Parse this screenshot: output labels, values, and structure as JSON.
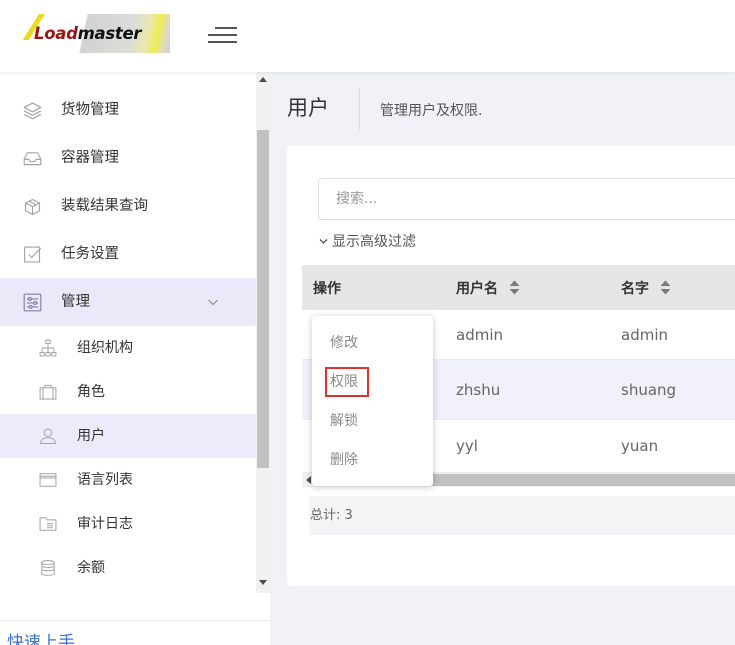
{
  "header": {
    "logo": {
      "part1": "Load",
      "part2": "master"
    },
    "menu_icon": "hamburger-icon"
  },
  "sidebar": {
    "items": [
      {
        "label": "货物管理",
        "icon": "layers-icon"
      },
      {
        "label": "容器管理",
        "icon": "inbox-icon"
      },
      {
        "label": "装载结果查询",
        "icon": "package-icon"
      },
      {
        "label": "任务设置",
        "icon": "checkbox-icon"
      },
      {
        "label": "管理",
        "icon": "sliders-icon",
        "active": true,
        "expanded": true
      }
    ],
    "sub_items": [
      {
        "label": "组织机构",
        "icon": "org-chart-icon"
      },
      {
        "label": "角色",
        "icon": "briefcase-icon"
      },
      {
        "label": "用户",
        "icon": "user-icon",
        "active": true
      },
      {
        "label": "语言列表",
        "icon": "window-icon"
      },
      {
        "label": "审计日志",
        "icon": "file-icon"
      },
      {
        "label": "余额",
        "icon": "coins-icon"
      }
    ],
    "footer_link": "快速上手"
  },
  "page": {
    "title": "用户",
    "subtitle": "管理用户及权限."
  },
  "search": {
    "placeholder": "搜索..."
  },
  "filter_toggle": {
    "label": "显示高级过滤",
    "icon": "chevron-down-icon"
  },
  "table": {
    "columns": [
      {
        "label": "操作",
        "sortable": false
      },
      {
        "label": "用户名",
        "sortable": true
      },
      {
        "label": "名字",
        "sortable": true
      }
    ],
    "rows": [
      {
        "username": "admin",
        "name": "admin",
        "highlighted": false
      },
      {
        "username": "zhshu",
        "name": "shuang",
        "highlighted": true
      },
      {
        "username": "yyl",
        "name": "yuan",
        "highlighted": false
      }
    ],
    "total": "总计: 3"
  },
  "action_menu": {
    "items": [
      {
        "label": "修改"
      },
      {
        "label": "权限",
        "outlined": true
      },
      {
        "label": "解锁"
      },
      {
        "label": "删除"
      }
    ]
  },
  "colors": {
    "main_bg": "#f1f2f7",
    "sidebar_active_bg": "#e9e9f9",
    "sub_active_bg": "#ebebfb",
    "row_highlight_bg": "#f1f1fb",
    "table_header_bg": "#e6e6e6",
    "link": "#3b73d8",
    "outline_red": "#e0312d",
    "icon_gray": "#a3a3a3"
  }
}
